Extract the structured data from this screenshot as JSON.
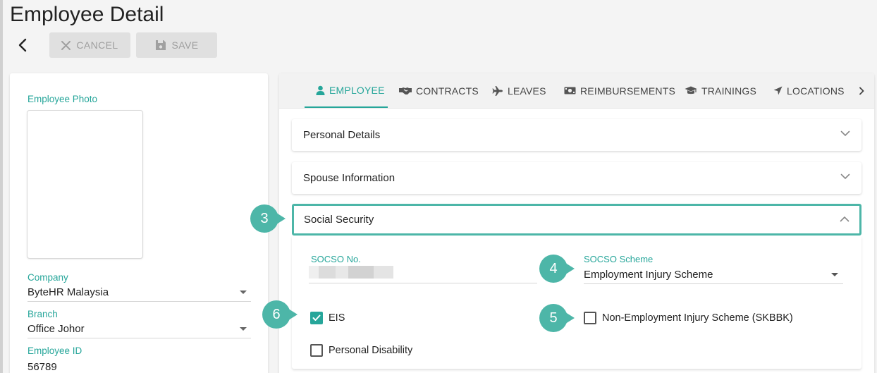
{
  "page": {
    "title": "Employee Detail"
  },
  "toolbar": {
    "cancel_label": "CANCEL",
    "save_label": "SAVE"
  },
  "left": {
    "photo_label": "Employee Photo",
    "company_label": "Company",
    "company_value": "ByteHR Malaysia",
    "branch_label": "Branch",
    "branch_value": "Office Johor",
    "employee_id_label": "Employee ID",
    "employee_id_value": "56789"
  },
  "tabs": [
    {
      "label": "EMPLOYEE",
      "icon": "person-icon",
      "active": true
    },
    {
      "label": "CONTRACTS",
      "icon": "handshake-icon"
    },
    {
      "label": "LEAVES",
      "icon": "airplane-icon"
    },
    {
      "label": "REIMBURSEMENTS",
      "icon": "money-icon"
    },
    {
      "label": "TRAININGS",
      "icon": "graduation-cap-icon"
    },
    {
      "label": "LOCATIONS",
      "icon": "location-arrow-icon"
    }
  ],
  "panels": {
    "personal": "Personal Details",
    "spouse": "Spouse Information",
    "social": "Social Security"
  },
  "social_security": {
    "socso_no_label": "SOCSO No.",
    "socso_scheme_label": "SOCSO Scheme",
    "socso_scheme_value": "Employment Injury Scheme",
    "eis_label": "EIS",
    "eis_checked": true,
    "skbbk_label": "Non-Employment Injury Scheme (SKBBK)",
    "skbbk_checked": false,
    "disability_label": "Personal Disability",
    "disability_checked": false
  },
  "callouts": [
    "3",
    "4",
    "5",
    "6"
  ],
  "colors": {
    "accent": "#26a69a",
    "callout": "#4db6a8",
    "button_bg": "#e0e0e0"
  }
}
